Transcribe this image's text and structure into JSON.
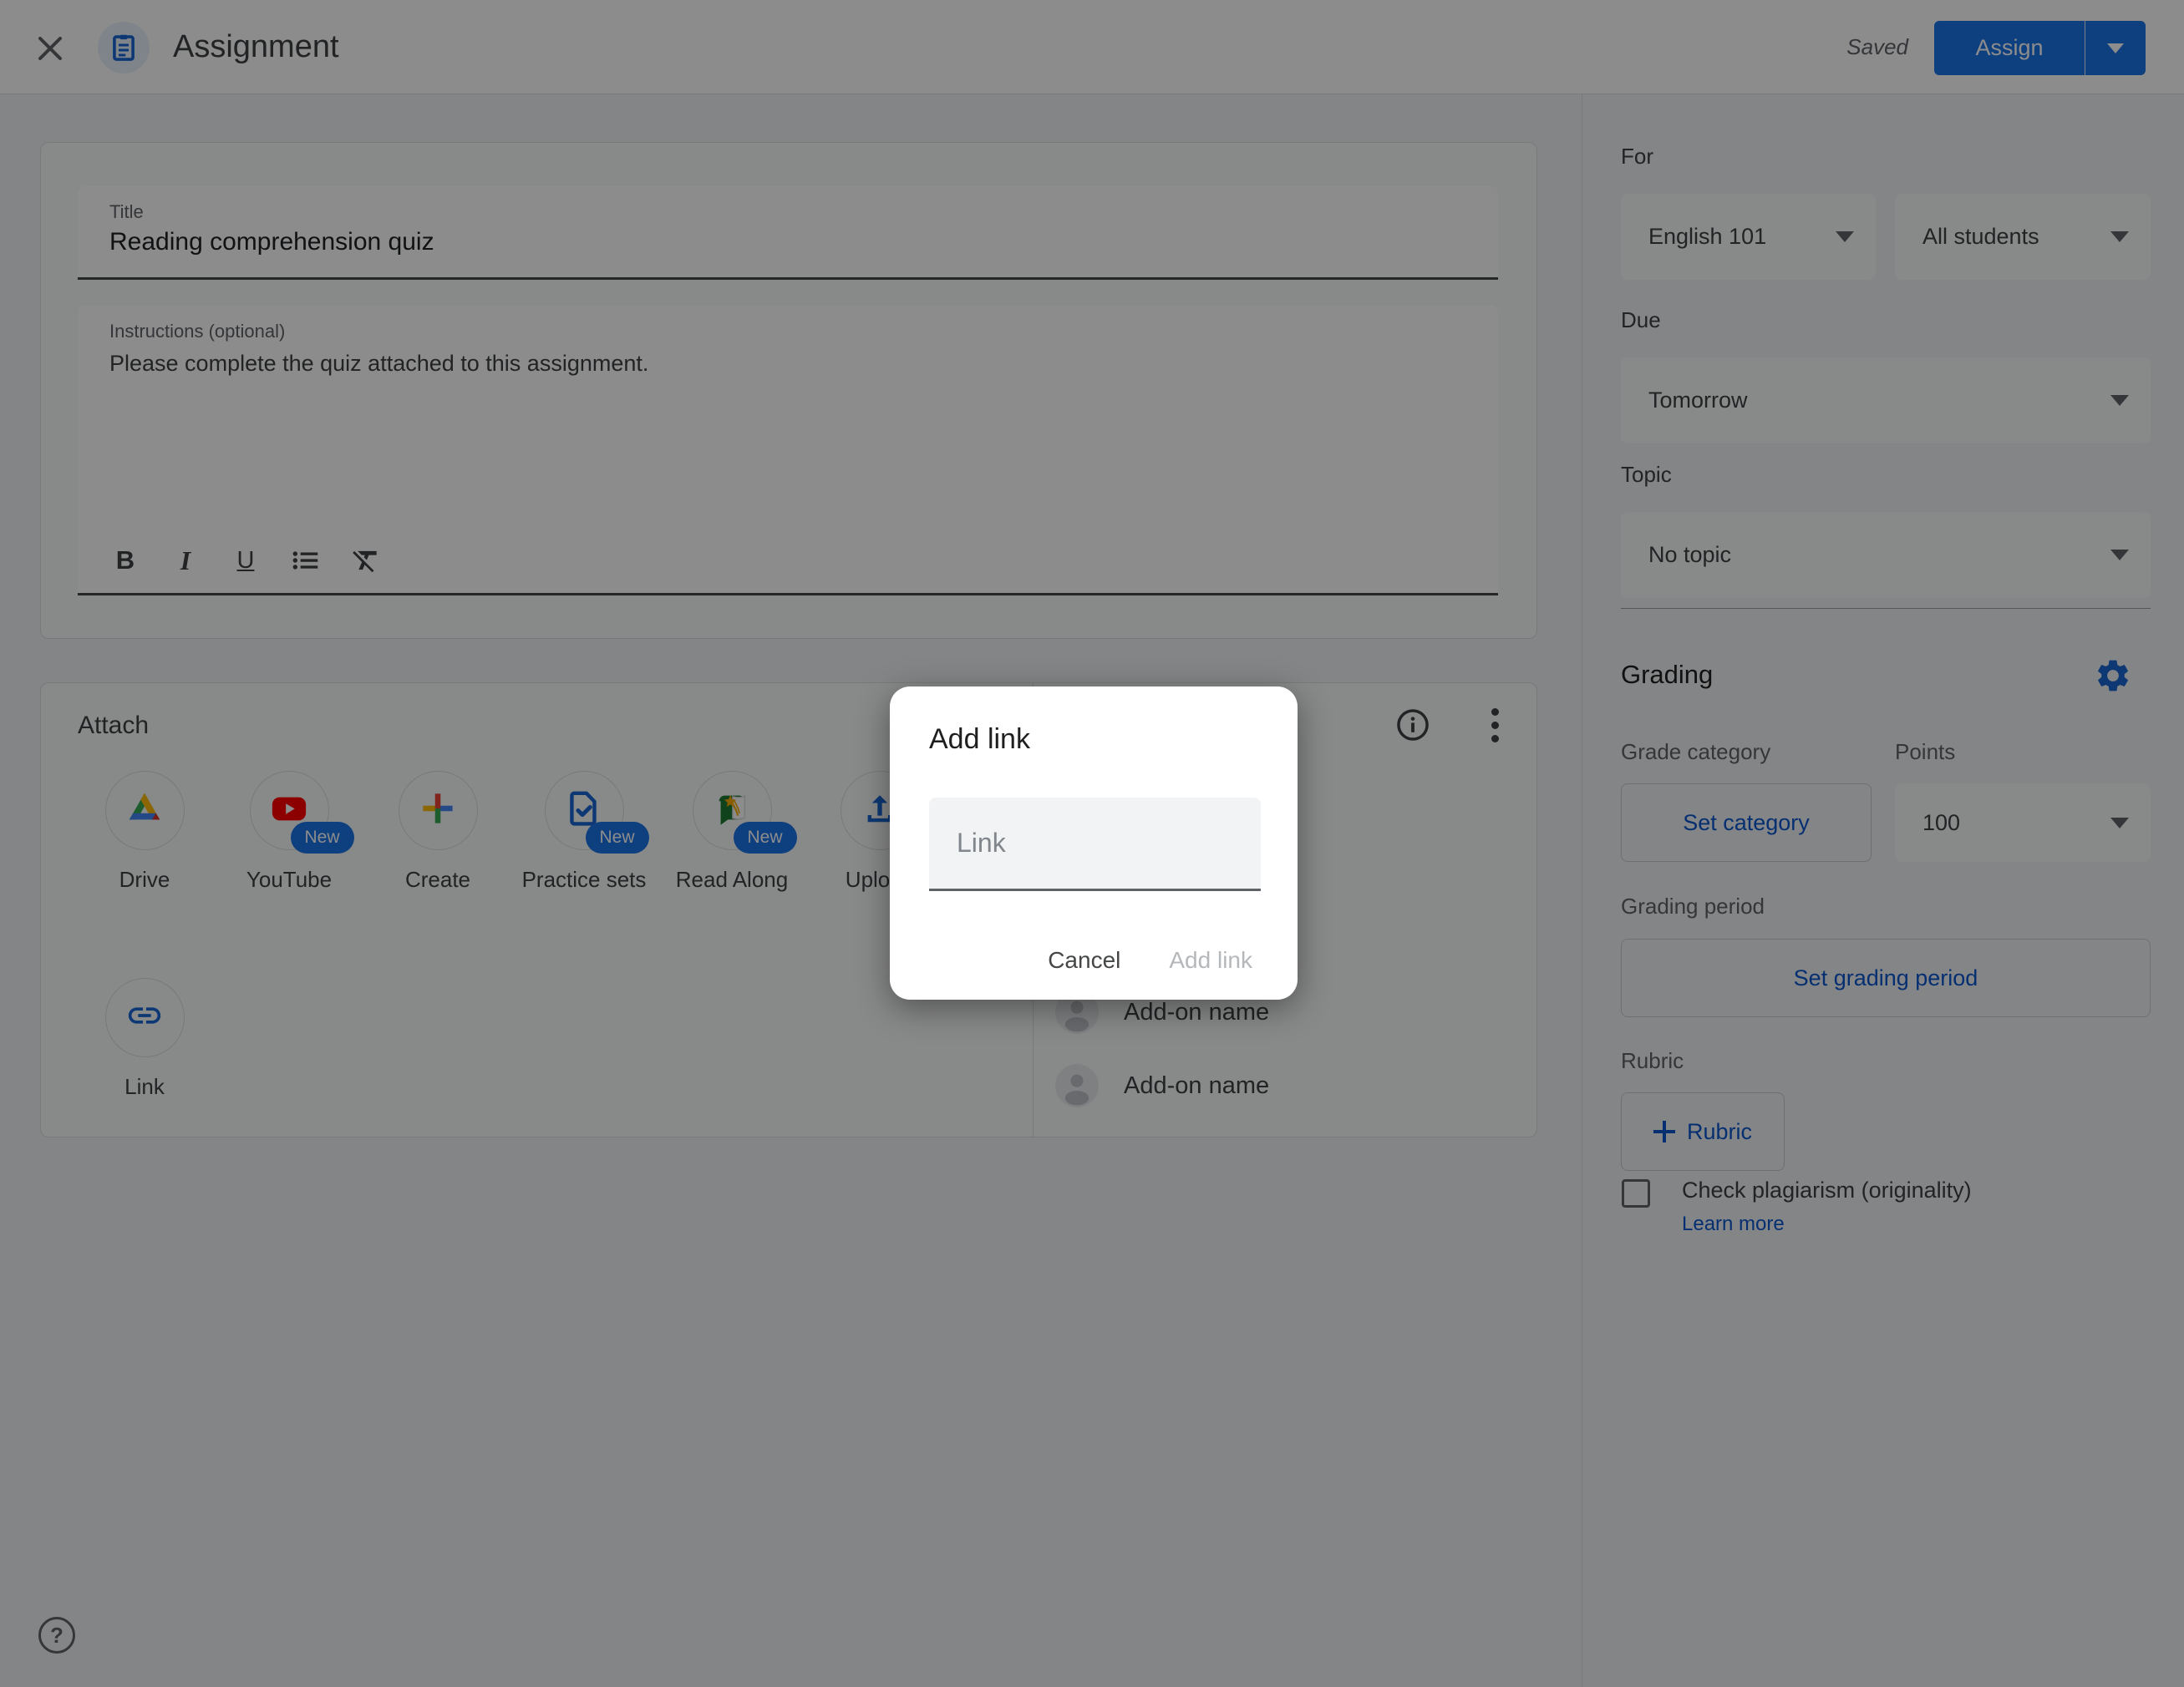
{
  "colors": {
    "accent_blue": "#1a73e8",
    "link_blue": "#0b57d0",
    "icon_blue": "#1967d2",
    "page_bg": "#f1f3f4",
    "card_bg": "#f8f9fa",
    "border": "#dadce0",
    "scrim": "rgba(0,0,0,0.45)"
  },
  "header": {
    "title": "Assignment",
    "saved_status": "Saved",
    "assign_label": "Assign"
  },
  "form": {
    "title_label": "Title",
    "title_value": "Reading comprehension quiz",
    "instructions_label": "Instructions (optional)",
    "instructions_value": "Please complete the quiz attached to this assignment.",
    "toolbar": {
      "bold": "B",
      "italic": "I",
      "underline": "U"
    }
  },
  "attach": {
    "section_label": "Attach",
    "options": [
      {
        "label": "Drive"
      },
      {
        "label": "YouTube",
        "badge": "New"
      },
      {
        "label": "Create"
      },
      {
        "label": "Practice sets",
        "badge": "New"
      },
      {
        "label": "Read Along",
        "badge": "New"
      },
      {
        "label": "Upload"
      },
      {
        "label": "Link"
      }
    ],
    "addons": [
      "Add-on name",
      "Add-on name",
      "Add-on name",
      "Add-on name",
      "Add-on name"
    ]
  },
  "modal": {
    "title": "Add link",
    "input_placeholder": "Link",
    "cancel_label": "Cancel",
    "submit_label": "Add link"
  },
  "sidebar": {
    "for_label": "For",
    "course": "English 101",
    "assignees": "All students",
    "due_label": "Due",
    "due_value": "Tomorrow",
    "topic_label": "Topic",
    "topic_value": "No topic",
    "grading_label": "Grading",
    "grade_category_label": "Grade category",
    "set_category_label": "Set category",
    "points_label": "Points",
    "points_value": "100",
    "grading_period_label": "Grading period",
    "set_grading_period_label": "Set grading period",
    "rubric_label": "Rubric",
    "add_rubric_label": "Rubric",
    "plagiarism_label": "Check plagiarism (originality)",
    "learn_more_label": "Learn more"
  },
  "footer": {
    "help_glyph": "?"
  }
}
